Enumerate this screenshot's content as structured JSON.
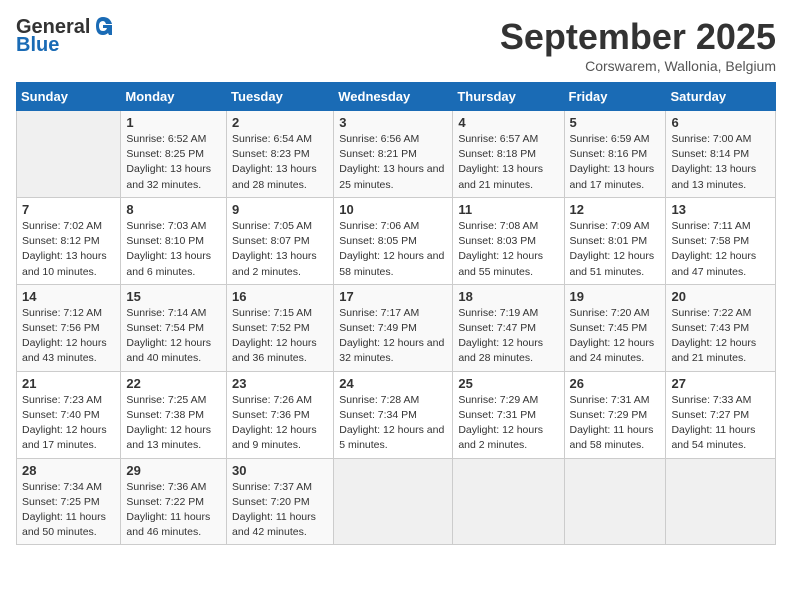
{
  "header": {
    "logo_general": "General",
    "logo_blue": "Blue",
    "month_title": "September 2025",
    "subtitle": "Corswarem, Wallonia, Belgium"
  },
  "days_of_week": [
    "Sunday",
    "Monday",
    "Tuesday",
    "Wednesday",
    "Thursday",
    "Friday",
    "Saturday"
  ],
  "weeks": [
    [
      {
        "day": "",
        "sunrise": "",
        "sunset": "",
        "daylight": ""
      },
      {
        "day": "1",
        "sunrise": "Sunrise: 6:52 AM",
        "sunset": "Sunset: 8:25 PM",
        "daylight": "Daylight: 13 hours and 32 minutes."
      },
      {
        "day": "2",
        "sunrise": "Sunrise: 6:54 AM",
        "sunset": "Sunset: 8:23 PM",
        "daylight": "Daylight: 13 hours and 28 minutes."
      },
      {
        "day": "3",
        "sunrise": "Sunrise: 6:56 AM",
        "sunset": "Sunset: 8:21 PM",
        "daylight": "Daylight: 13 hours and 25 minutes."
      },
      {
        "day": "4",
        "sunrise": "Sunrise: 6:57 AM",
        "sunset": "Sunset: 8:18 PM",
        "daylight": "Daylight: 13 hours and 21 minutes."
      },
      {
        "day": "5",
        "sunrise": "Sunrise: 6:59 AM",
        "sunset": "Sunset: 8:16 PM",
        "daylight": "Daylight: 13 hours and 17 minutes."
      },
      {
        "day": "6",
        "sunrise": "Sunrise: 7:00 AM",
        "sunset": "Sunset: 8:14 PM",
        "daylight": "Daylight: 13 hours and 13 minutes."
      }
    ],
    [
      {
        "day": "7",
        "sunrise": "Sunrise: 7:02 AM",
        "sunset": "Sunset: 8:12 PM",
        "daylight": "Daylight: 13 hours and 10 minutes."
      },
      {
        "day": "8",
        "sunrise": "Sunrise: 7:03 AM",
        "sunset": "Sunset: 8:10 PM",
        "daylight": "Daylight: 13 hours and 6 minutes."
      },
      {
        "day": "9",
        "sunrise": "Sunrise: 7:05 AM",
        "sunset": "Sunset: 8:07 PM",
        "daylight": "Daylight: 13 hours and 2 minutes."
      },
      {
        "day": "10",
        "sunrise": "Sunrise: 7:06 AM",
        "sunset": "Sunset: 8:05 PM",
        "daylight": "Daylight: 12 hours and 58 minutes."
      },
      {
        "day": "11",
        "sunrise": "Sunrise: 7:08 AM",
        "sunset": "Sunset: 8:03 PM",
        "daylight": "Daylight: 12 hours and 55 minutes."
      },
      {
        "day": "12",
        "sunrise": "Sunrise: 7:09 AM",
        "sunset": "Sunset: 8:01 PM",
        "daylight": "Daylight: 12 hours and 51 minutes."
      },
      {
        "day": "13",
        "sunrise": "Sunrise: 7:11 AM",
        "sunset": "Sunset: 7:58 PM",
        "daylight": "Daylight: 12 hours and 47 minutes."
      }
    ],
    [
      {
        "day": "14",
        "sunrise": "Sunrise: 7:12 AM",
        "sunset": "Sunset: 7:56 PM",
        "daylight": "Daylight: 12 hours and 43 minutes."
      },
      {
        "day": "15",
        "sunrise": "Sunrise: 7:14 AM",
        "sunset": "Sunset: 7:54 PM",
        "daylight": "Daylight: 12 hours and 40 minutes."
      },
      {
        "day": "16",
        "sunrise": "Sunrise: 7:15 AM",
        "sunset": "Sunset: 7:52 PM",
        "daylight": "Daylight: 12 hours and 36 minutes."
      },
      {
        "day": "17",
        "sunrise": "Sunrise: 7:17 AM",
        "sunset": "Sunset: 7:49 PM",
        "daylight": "Daylight: 12 hours and 32 minutes."
      },
      {
        "day": "18",
        "sunrise": "Sunrise: 7:19 AM",
        "sunset": "Sunset: 7:47 PM",
        "daylight": "Daylight: 12 hours and 28 minutes."
      },
      {
        "day": "19",
        "sunrise": "Sunrise: 7:20 AM",
        "sunset": "Sunset: 7:45 PM",
        "daylight": "Daylight: 12 hours and 24 minutes."
      },
      {
        "day": "20",
        "sunrise": "Sunrise: 7:22 AM",
        "sunset": "Sunset: 7:43 PM",
        "daylight": "Daylight: 12 hours and 21 minutes."
      }
    ],
    [
      {
        "day": "21",
        "sunrise": "Sunrise: 7:23 AM",
        "sunset": "Sunset: 7:40 PM",
        "daylight": "Daylight: 12 hours and 17 minutes."
      },
      {
        "day": "22",
        "sunrise": "Sunrise: 7:25 AM",
        "sunset": "Sunset: 7:38 PM",
        "daylight": "Daylight: 12 hours and 13 minutes."
      },
      {
        "day": "23",
        "sunrise": "Sunrise: 7:26 AM",
        "sunset": "Sunset: 7:36 PM",
        "daylight": "Daylight: 12 hours and 9 minutes."
      },
      {
        "day": "24",
        "sunrise": "Sunrise: 7:28 AM",
        "sunset": "Sunset: 7:34 PM",
        "daylight": "Daylight: 12 hours and 5 minutes."
      },
      {
        "day": "25",
        "sunrise": "Sunrise: 7:29 AM",
        "sunset": "Sunset: 7:31 PM",
        "daylight": "Daylight: 12 hours and 2 minutes."
      },
      {
        "day": "26",
        "sunrise": "Sunrise: 7:31 AM",
        "sunset": "Sunset: 7:29 PM",
        "daylight": "Daylight: 11 hours and 58 minutes."
      },
      {
        "day": "27",
        "sunrise": "Sunrise: 7:33 AM",
        "sunset": "Sunset: 7:27 PM",
        "daylight": "Daylight: 11 hours and 54 minutes."
      }
    ],
    [
      {
        "day": "28",
        "sunrise": "Sunrise: 7:34 AM",
        "sunset": "Sunset: 7:25 PM",
        "daylight": "Daylight: 11 hours and 50 minutes."
      },
      {
        "day": "29",
        "sunrise": "Sunrise: 7:36 AM",
        "sunset": "Sunset: 7:22 PM",
        "daylight": "Daylight: 11 hours and 46 minutes."
      },
      {
        "day": "30",
        "sunrise": "Sunrise: 7:37 AM",
        "sunset": "Sunset: 7:20 PM",
        "daylight": "Daylight: 11 hours and 42 minutes."
      },
      {
        "day": "",
        "sunrise": "",
        "sunset": "",
        "daylight": ""
      },
      {
        "day": "",
        "sunrise": "",
        "sunset": "",
        "daylight": ""
      },
      {
        "day": "",
        "sunrise": "",
        "sunset": "",
        "daylight": ""
      },
      {
        "day": "",
        "sunrise": "",
        "sunset": "",
        "daylight": ""
      }
    ]
  ]
}
